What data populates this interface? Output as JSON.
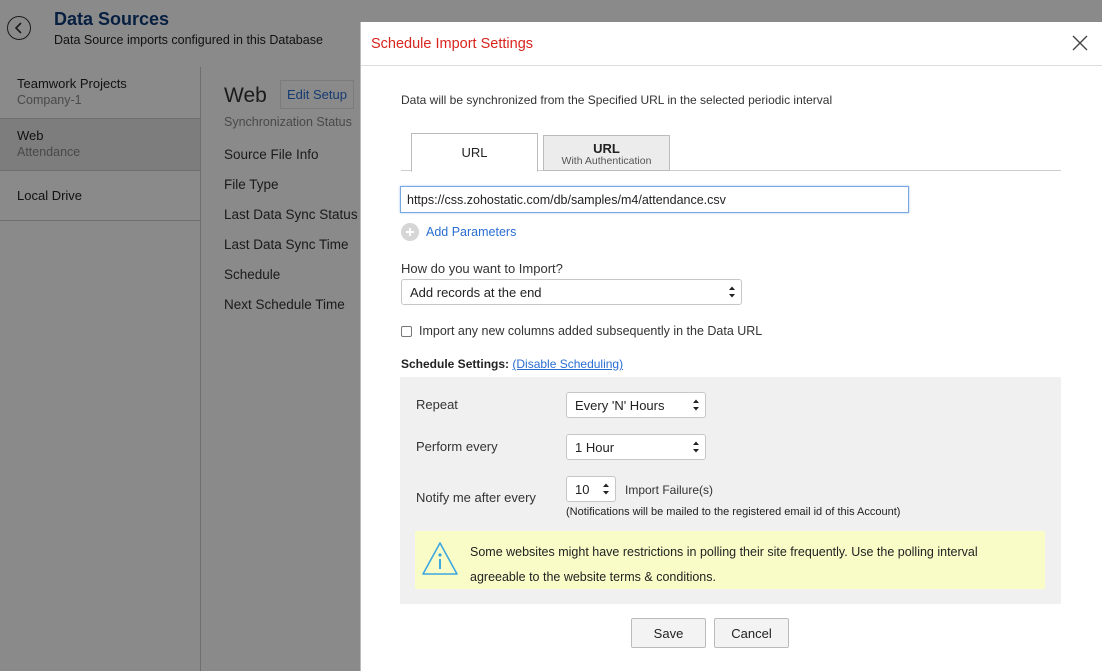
{
  "page": {
    "title": "Data Sources",
    "subtitle": "Data Source imports configured in this Database"
  },
  "nav": {
    "items": [
      {
        "title": "Teamwork Projects",
        "sub": "Company-1"
      },
      {
        "title": "Web",
        "sub": "Attendance"
      },
      {
        "title": "Local Drive",
        "sub": ""
      }
    ]
  },
  "detail": {
    "title": "Web",
    "edit_label": "Edit Setup",
    "sync_status": "Synchronization Status",
    "fields": [
      "Source File Info",
      "File Type",
      "Last Data Sync Status",
      "Last Data Sync Time",
      "Schedule",
      "Next Schedule Time"
    ]
  },
  "modal": {
    "title": "Schedule Import Settings",
    "description": "Data will be synchronized from the Specified URL in the selected periodic interval",
    "tabs": {
      "url": "URL",
      "auth_title": "URL",
      "auth_sub": "With Authentication"
    },
    "url_value": "https://css.zohostatic.com/db/samples/m4/attendance.csv",
    "add_params": "Add Parameters",
    "import_question": "How do you want to Import?",
    "import_mode": "Add records at the end",
    "new_columns_label": "Import any new columns added subsequently in the Data URL",
    "schedule_label": "Schedule Settings:",
    "disable_link": "(Disable Scheduling)",
    "repeat_label": "Repeat",
    "repeat_value": "Every 'N' Hours",
    "perform_label": "Perform every",
    "perform_value": "1 Hour",
    "notify_label": "Notify me after every",
    "notify_value": "10",
    "failure_label": "Import Failure(s)",
    "notify_note": "(Notifications will be mailed to the registered email id of this Account)",
    "warning_text": "Some websites might have restrictions in polling their site frequently. Use the polling interval agreeable to the website terms & conditions.",
    "save_label": "Save",
    "cancel_label": "Cancel"
  },
  "colors": {
    "accent_blue": "#2a6dd1",
    "title_red": "#d9241e",
    "header_navy": "#0d3a78",
    "warning_bg": "#fafcc8"
  }
}
